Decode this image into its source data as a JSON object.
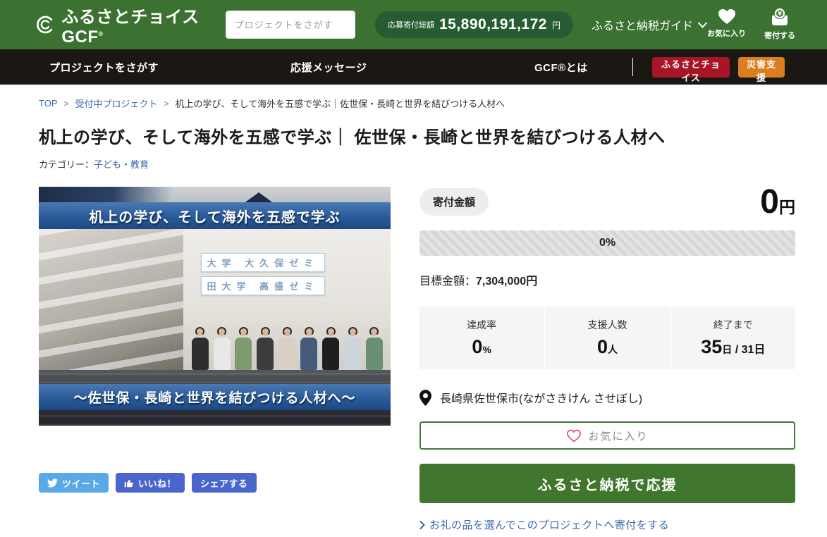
{
  "header": {
    "logo_text": "ふるさとチョイスGCF",
    "logo_reg": "®",
    "search_placeholder": "プロジェクトをさがす",
    "total_label": "応募寄付総額",
    "total_amount": "15,890,191,172",
    "total_unit": "円",
    "guide_label": "ふるさと納税ガイド",
    "favorites_label": "お気に入り",
    "donate_label": "寄付する"
  },
  "nav": {
    "item_search": "プロジェクトをさがす",
    "item_message": "応援メッセージ",
    "item_about": "GCF®とは",
    "btn_choice": "ふるさとチョイス",
    "btn_disaster": "災害支援"
  },
  "breadcrumb": {
    "top": "TOP",
    "listing": "受付中プロジェクト",
    "current": "机上の学び、そして海外を五感で学ぶ｜佐世保・長崎と世界を結びつける人材へ",
    "separator": ">"
  },
  "page": {
    "title": "机上の学び、そして海外を五感で学ぶ｜ 佐世保・長崎と世界を結びつける人材へ",
    "category_label": "カテゴリー：",
    "category_link": "子ども・教育"
  },
  "hero": {
    "banner_top": "机上の学び、そして海外を五感で学ぶ",
    "banner_bottom": "～佐世保・長崎と世界を結びつける人材へ～",
    "sign_row1": "大学 大久保ゼミ",
    "sign_row2": "田大学 高盛ゼミ"
  },
  "share": {
    "tweet": "ツイート",
    "like": "いいね！",
    "share": "シェアする"
  },
  "donation": {
    "amount_label": "寄付金額",
    "amount_value": "0",
    "amount_unit": "円",
    "progress_percent": "0%",
    "goal_label": "目標金額：",
    "goal_value": "7,304,000円",
    "stats": [
      {
        "label": "達成率",
        "big": "0",
        "small": "%",
        "rest": ""
      },
      {
        "label": "支援人数",
        "big": "0",
        "small": "人",
        "rest": ""
      },
      {
        "label": "終了まで",
        "big": "35",
        "small": "日",
        "rest": " / 31日"
      }
    ],
    "location": "長崎県佐世保市(ながさきけん させぼし)",
    "favorite_button": "お気に入り",
    "cta_button": "ふるさと納税で応援",
    "reward_link": "お礼の品を選んでこのプロジェクトへ寄付をする"
  },
  "colors": {
    "header_green": "#3b7232",
    "badge_green": "#265c31",
    "cta_green": "#40762d",
    "nav_black": "#1b1712",
    "button_red": "#a81527",
    "button_orange": "#d97f1d",
    "link_blue": "#3c67ad",
    "banner_blue": "#2a5a97",
    "twitter_blue": "#5aa9e6",
    "facebook_blue": "#4a66cc"
  }
}
